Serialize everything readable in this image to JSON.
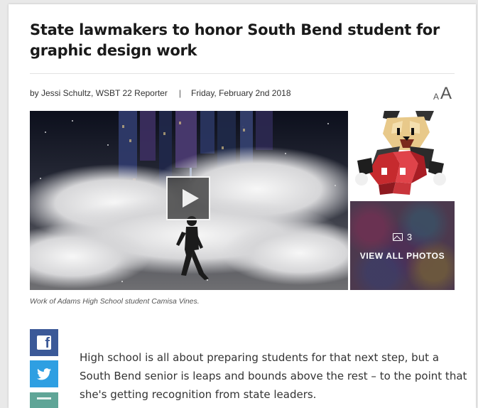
{
  "article": {
    "headline": "State lawmakers to honor South Bend student for graphic design work",
    "byline": "by Jessi Schultz, WSBT 22 Reporter",
    "separator": "|",
    "date": "Friday, February 2nd 2018",
    "text_size": {
      "small": "A",
      "large": "A"
    },
    "media": {
      "photo_count": "3",
      "view_all_label": "VIEW ALL PHOTOS",
      "caption": "Work of Adams High School student Camisa Vines."
    },
    "body": "High school is all about preparing students for that next step, but a South Bend senior is leaps and bounds above the rest – to the point that she's getting recognition from state leaders."
  },
  "share": {
    "items": [
      "facebook-icon",
      "twitter-icon",
      "email-icon"
    ],
    "colors": {
      "facebook": "#3b5998",
      "twitter": "#2e9fe2",
      "email": "#5fa597"
    }
  },
  "icons": {
    "play": "play-icon",
    "photos": "image-icon"
  }
}
